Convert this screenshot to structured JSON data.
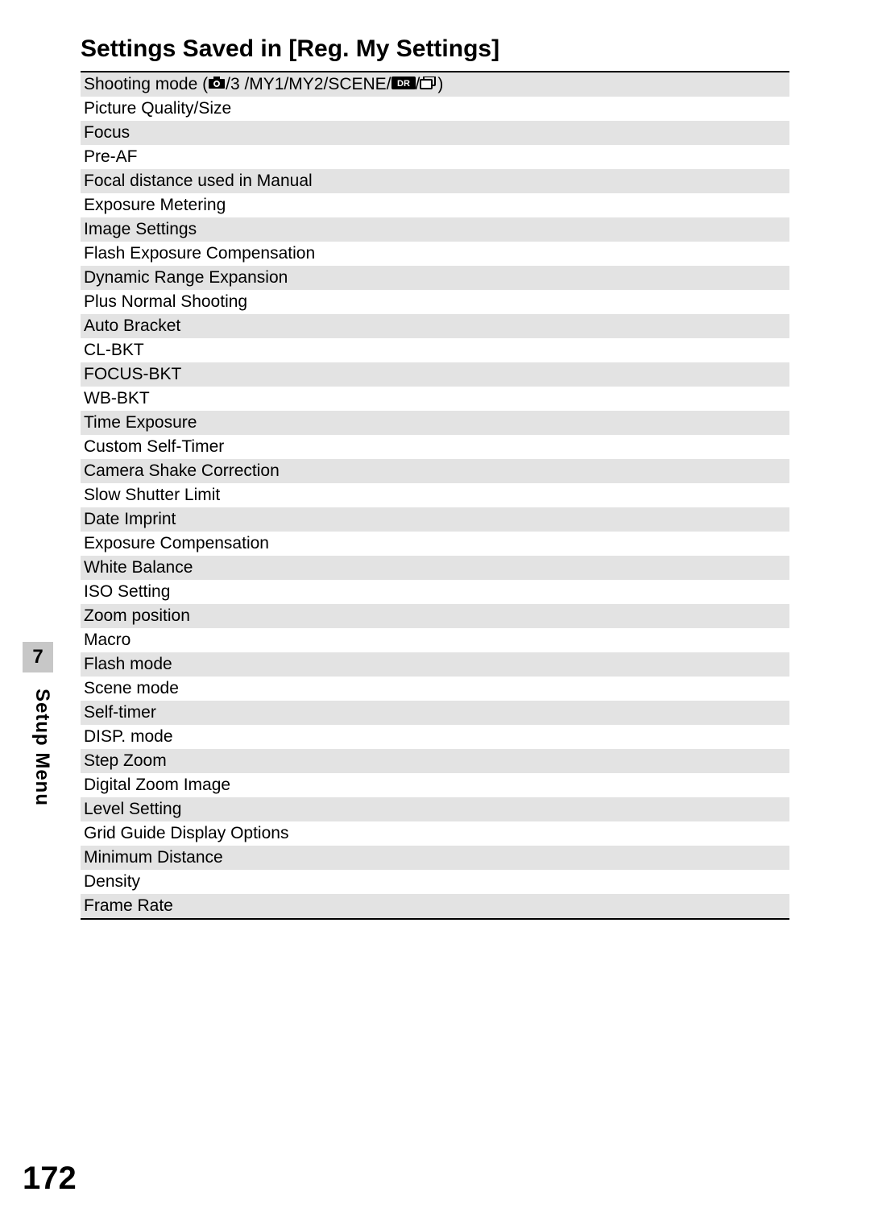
{
  "heading": "Settings Saved in [Reg. My Settings]",
  "rows": [
    {
      "label": "Shooting mode",
      "suffix": " (",
      "icon1": "camera",
      "mid1": "/3  /MY1/MY2/SCENE/",
      "icon2": "dr",
      "mid2": "/",
      "icon3": "continuous",
      "end": ")"
    },
    {
      "label": "Picture Quality/Size"
    },
    {
      "label": "Focus"
    },
    {
      "label": "Pre-AF"
    },
    {
      "label": "Focal distance used in Manual"
    },
    {
      "label": "Exposure Metering"
    },
    {
      "label": "Image Settings"
    },
    {
      "label": "Flash Exposure Compensation"
    },
    {
      "label": "Dynamic Range Expansion"
    },
    {
      "label": "Plus Normal Shooting"
    },
    {
      "label": "Auto Bracket"
    },
    {
      "label": "CL-BKT"
    },
    {
      "label": "FOCUS-BKT"
    },
    {
      "label": "WB-BKT"
    },
    {
      "label": "Time Exposure"
    },
    {
      "label": "Custom Self-Timer"
    },
    {
      "label": "Camera Shake Correction"
    },
    {
      "label": "Slow Shutter Limit"
    },
    {
      "label": "Date Imprint"
    },
    {
      "label": "Exposure Compensation"
    },
    {
      "label": "White Balance"
    },
    {
      "label": "ISO Setting"
    },
    {
      "label": "Zoom position"
    },
    {
      "label": "Macro"
    },
    {
      "label": "Flash mode"
    },
    {
      "label": "Scene mode"
    },
    {
      "label": "Self-timer"
    },
    {
      "label": "DISP. mode"
    },
    {
      "label": "Step Zoom"
    },
    {
      "label": "Digital Zoom Image"
    },
    {
      "label": "Level Setting"
    },
    {
      "label": "Grid Guide Display Options"
    },
    {
      "label": "Minimum Distance"
    },
    {
      "label": "Density"
    },
    {
      "label": "Frame Rate"
    }
  ],
  "side": {
    "number": "7",
    "label": "Setup Menu"
  },
  "page_number": "172",
  "icons": {
    "camera_svg": "<svg width='22' height='16' viewBox='0 0 22 16'><rect x='1' y='3' width='20' height='12' rx='1' fill='#000'/><rect x='7' y='0' width='8' height='4' fill='#000'/><circle cx='11' cy='9' r='4' fill='#fff'/><circle cx='11' cy='9' r='2.2' fill='#000'/></svg>",
    "dr_svg": "<svg width='30' height='16' viewBox='0 0 30 16'><rect x='0' y='0' width='30' height='16' rx='2' fill='#000'/><text x='15' y='12' font-family=\"Arial\" font-size='11' font-weight='bold' fill='#fff' text-anchor='middle'>DR</text></svg>",
    "continuous_svg": "<svg width='22' height='16' viewBox='0 0 22 16'><rect x='5' y='0' width='14' height='11' rx='1' fill='none' stroke='#000' stroke-width='2'/><rect x='1' y='4' width='14' height='11' rx='1' fill='#fff' stroke='#000' stroke-width='2'/></svg>"
  }
}
